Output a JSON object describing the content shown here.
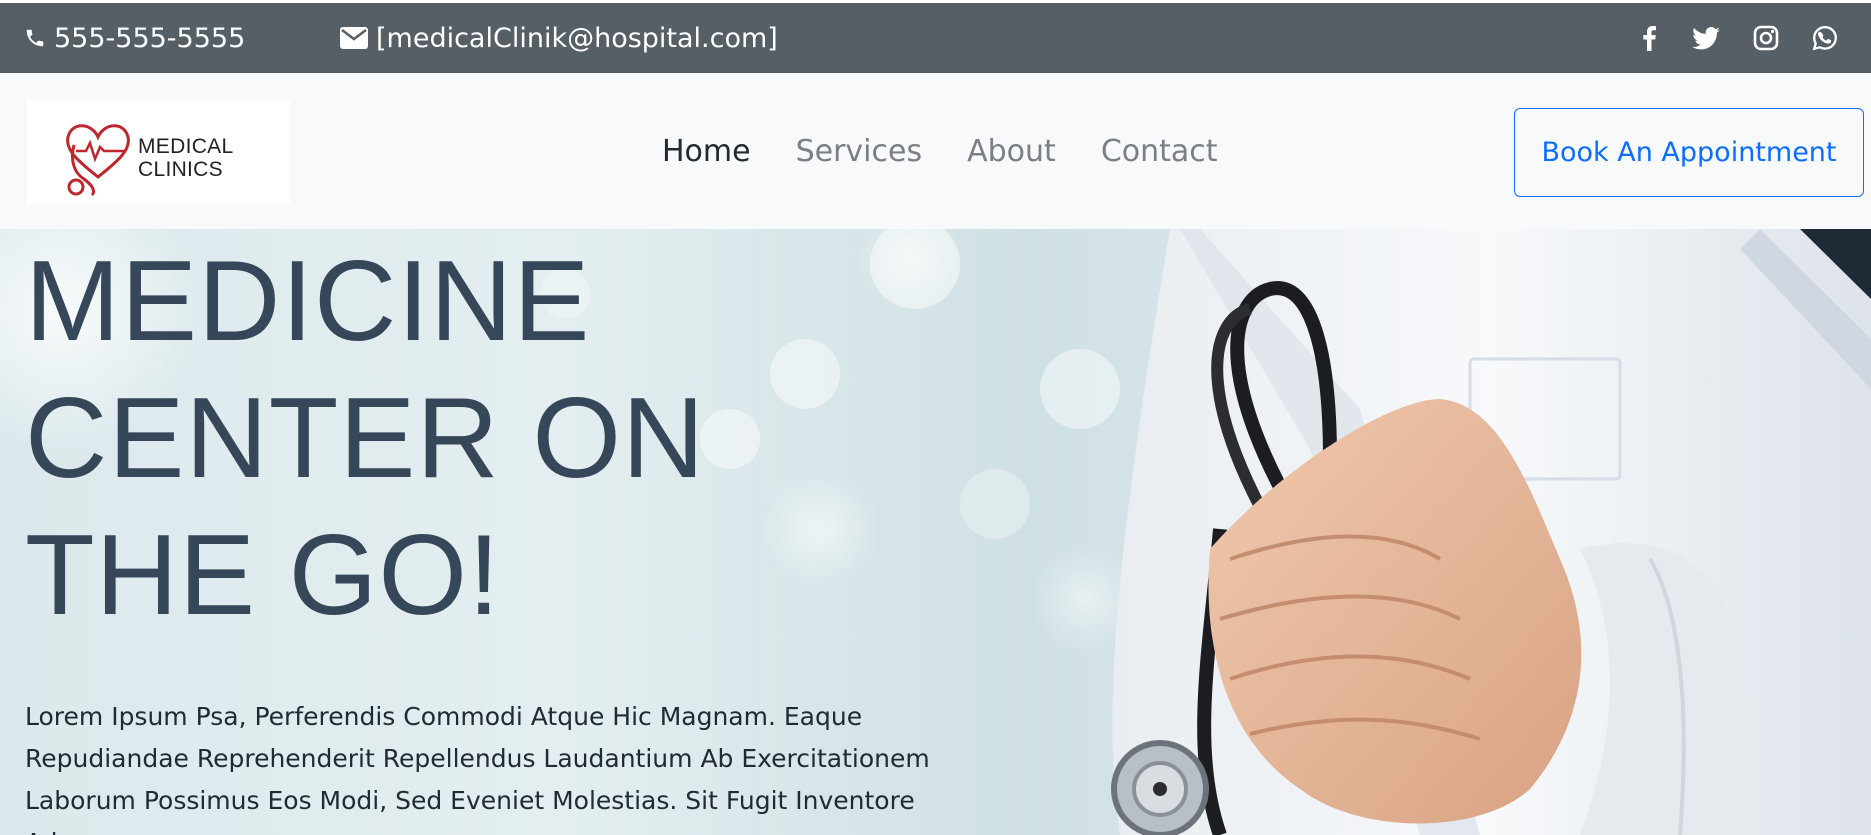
{
  "topbar": {
    "phone": "555-555-5555",
    "email": "[medicalClinik@hospital.com]",
    "phone_icon": "phone-icon",
    "email_icon": "envelope-icon",
    "social": [
      "facebook-icon",
      "twitter-icon",
      "instagram-icon",
      "whatsapp-icon"
    ]
  },
  "navbar": {
    "logo": {
      "line1": "MEDICAL",
      "line2": "CLINICS",
      "icon": "heart-stethoscope-icon"
    },
    "links": [
      {
        "label": "Home",
        "active": true
      },
      {
        "label": "Services",
        "active": false
      },
      {
        "label": "About",
        "active": false
      },
      {
        "label": "Contact",
        "active": false
      }
    ],
    "cta": "Book An Appointment"
  },
  "hero": {
    "title_lines": [
      "MEDICINE",
      "CENTER ON",
      "THE GO!"
    ],
    "paragraph": "Lorem Ipsum Psa, Perferendis Commodi Atque Hic Magnam. Eaque Repudiandae Reprehenderit Repellendus Laudantium Ab Exercitationem Laborum Possimus Eos Modi, Sed Eveniet Molestias. Sit Fugit Inventore Ad"
  },
  "colors": {
    "topbar_bg": "#565e66",
    "navbar_bg": "#f8f9fa",
    "accent": "#0d6efd",
    "hero_title": "#37475a",
    "logo_red": "#c0272d"
  }
}
